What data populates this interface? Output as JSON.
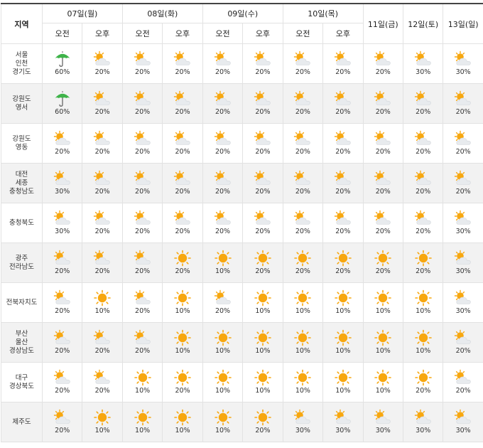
{
  "header": {
    "region_label": "지역",
    "days_split": [
      {
        "label": "07일(월)"
      },
      {
        "label": "08일(화)"
      },
      {
        "label": "09일(수)"
      },
      {
        "label": "10일(목)"
      }
    ],
    "days_single": [
      {
        "label": "11일(금)"
      },
      {
        "label": "12일(토)"
      },
      {
        "label": "13일(일)"
      }
    ],
    "am_label": "오전",
    "pm_label": "오후"
  },
  "rows": [
    {
      "region": "서울\n인천\n경기도",
      "cells": [
        {
          "icon": "umbrella-icon",
          "pct": "60%"
        },
        {
          "icon": "partly-cloudy-icon",
          "pct": "20%"
        },
        {
          "icon": "partly-cloudy-icon",
          "pct": "20%"
        },
        {
          "icon": "partly-cloudy-icon",
          "pct": "20%"
        },
        {
          "icon": "partly-cloudy-icon",
          "pct": "20%"
        },
        {
          "icon": "partly-cloudy-icon",
          "pct": "20%"
        },
        {
          "icon": "partly-cloudy-icon",
          "pct": "20%"
        },
        {
          "icon": "partly-cloudy-icon",
          "pct": "20%"
        },
        {
          "icon": "partly-cloudy-icon",
          "pct": "20%"
        },
        {
          "icon": "partly-cloudy-icon",
          "pct": "30%"
        },
        {
          "icon": "partly-cloudy-icon",
          "pct": "30%"
        }
      ]
    },
    {
      "region": "강원도\n영서",
      "cells": [
        {
          "icon": "umbrella-icon",
          "pct": "60%"
        },
        {
          "icon": "partly-cloudy-icon",
          "pct": "20%"
        },
        {
          "icon": "partly-cloudy-icon",
          "pct": "20%"
        },
        {
          "icon": "partly-cloudy-icon",
          "pct": "20%"
        },
        {
          "icon": "partly-cloudy-icon",
          "pct": "20%"
        },
        {
          "icon": "partly-cloudy-icon",
          "pct": "20%"
        },
        {
          "icon": "partly-cloudy-icon",
          "pct": "20%"
        },
        {
          "icon": "partly-cloudy-icon",
          "pct": "20%"
        },
        {
          "icon": "partly-cloudy-icon",
          "pct": "20%"
        },
        {
          "icon": "partly-cloudy-icon",
          "pct": "20%"
        },
        {
          "icon": "partly-cloudy-icon",
          "pct": "20%"
        }
      ]
    },
    {
      "region": "강원도\n영동",
      "cells": [
        {
          "icon": "partly-cloudy-icon",
          "pct": "20%"
        },
        {
          "icon": "partly-cloudy-icon",
          "pct": "20%"
        },
        {
          "icon": "partly-cloudy-icon",
          "pct": "20%"
        },
        {
          "icon": "partly-cloudy-icon",
          "pct": "20%"
        },
        {
          "icon": "partly-cloudy-icon",
          "pct": "20%"
        },
        {
          "icon": "partly-cloudy-icon",
          "pct": "20%"
        },
        {
          "icon": "partly-cloudy-icon",
          "pct": "20%"
        },
        {
          "icon": "partly-cloudy-icon",
          "pct": "20%"
        },
        {
          "icon": "partly-cloudy-icon",
          "pct": "20%"
        },
        {
          "icon": "partly-cloudy-icon",
          "pct": "20%"
        },
        {
          "icon": "partly-cloudy-icon",
          "pct": "20%"
        }
      ]
    },
    {
      "region": "대전\n세종\n충청남도",
      "cells": [
        {
          "icon": "partly-cloudy-icon",
          "pct": "30%"
        },
        {
          "icon": "partly-cloudy-icon",
          "pct": "20%"
        },
        {
          "icon": "partly-cloudy-icon",
          "pct": "20%"
        },
        {
          "icon": "partly-cloudy-icon",
          "pct": "20%"
        },
        {
          "icon": "partly-cloudy-icon",
          "pct": "20%"
        },
        {
          "icon": "partly-cloudy-icon",
          "pct": "20%"
        },
        {
          "icon": "partly-cloudy-icon",
          "pct": "20%"
        },
        {
          "icon": "partly-cloudy-icon",
          "pct": "20%"
        },
        {
          "icon": "partly-cloudy-icon",
          "pct": "20%"
        },
        {
          "icon": "partly-cloudy-icon",
          "pct": "20%"
        },
        {
          "icon": "partly-cloudy-icon",
          "pct": "20%"
        }
      ]
    },
    {
      "region": "충청북도",
      "cells": [
        {
          "icon": "partly-cloudy-icon",
          "pct": "30%"
        },
        {
          "icon": "partly-cloudy-icon",
          "pct": "20%"
        },
        {
          "icon": "partly-cloudy-icon",
          "pct": "20%"
        },
        {
          "icon": "partly-cloudy-icon",
          "pct": "20%"
        },
        {
          "icon": "partly-cloudy-icon",
          "pct": "20%"
        },
        {
          "icon": "partly-cloudy-icon",
          "pct": "20%"
        },
        {
          "icon": "partly-cloudy-icon",
          "pct": "20%"
        },
        {
          "icon": "partly-cloudy-icon",
          "pct": "20%"
        },
        {
          "icon": "partly-cloudy-icon",
          "pct": "20%"
        },
        {
          "icon": "partly-cloudy-icon",
          "pct": "20%"
        },
        {
          "icon": "partly-cloudy-icon",
          "pct": "30%"
        }
      ]
    },
    {
      "region": "광주\n전라남도",
      "cells": [
        {
          "icon": "partly-cloudy-icon",
          "pct": "20%"
        },
        {
          "icon": "partly-cloudy-icon",
          "pct": "20%"
        },
        {
          "icon": "partly-cloudy-icon",
          "pct": "20%"
        },
        {
          "icon": "sun-icon",
          "pct": "20%"
        },
        {
          "icon": "sun-icon",
          "pct": "10%"
        },
        {
          "icon": "sun-icon",
          "pct": "20%"
        },
        {
          "icon": "sun-icon",
          "pct": "20%"
        },
        {
          "icon": "sun-icon",
          "pct": "20%"
        },
        {
          "icon": "sun-icon",
          "pct": "20%"
        },
        {
          "icon": "sun-icon",
          "pct": "20%"
        },
        {
          "icon": "partly-cloudy-icon",
          "pct": "30%"
        }
      ]
    },
    {
      "region": "전북자치도",
      "cells": [
        {
          "icon": "partly-cloudy-icon",
          "pct": "20%"
        },
        {
          "icon": "sun-icon",
          "pct": "10%"
        },
        {
          "icon": "partly-cloudy-icon",
          "pct": "20%"
        },
        {
          "icon": "sun-icon",
          "pct": "10%"
        },
        {
          "icon": "partly-cloudy-icon",
          "pct": "20%"
        },
        {
          "icon": "sun-icon",
          "pct": "10%"
        },
        {
          "icon": "sun-icon",
          "pct": "10%"
        },
        {
          "icon": "sun-icon",
          "pct": "10%"
        },
        {
          "icon": "sun-icon",
          "pct": "10%"
        },
        {
          "icon": "sun-icon",
          "pct": "10%"
        },
        {
          "icon": "partly-cloudy-icon",
          "pct": "30%"
        }
      ]
    },
    {
      "region": "부산\n울산\n경상남도",
      "cells": [
        {
          "icon": "partly-cloudy-icon",
          "pct": "20%"
        },
        {
          "icon": "partly-cloudy-icon",
          "pct": "20%"
        },
        {
          "icon": "partly-cloudy-icon",
          "pct": "20%"
        },
        {
          "icon": "sun-icon",
          "pct": "10%"
        },
        {
          "icon": "sun-icon",
          "pct": "10%"
        },
        {
          "icon": "sun-icon",
          "pct": "10%"
        },
        {
          "icon": "sun-icon",
          "pct": "10%"
        },
        {
          "icon": "sun-icon",
          "pct": "10%"
        },
        {
          "icon": "sun-icon",
          "pct": "10%"
        },
        {
          "icon": "sun-icon",
          "pct": "10%"
        },
        {
          "icon": "partly-cloudy-icon",
          "pct": "20%"
        }
      ]
    },
    {
      "region": "대구\n경상북도",
      "cells": [
        {
          "icon": "partly-cloudy-icon",
          "pct": "20%"
        },
        {
          "icon": "partly-cloudy-icon",
          "pct": "20%"
        },
        {
          "icon": "sun-icon",
          "pct": "10%"
        },
        {
          "icon": "sun-icon",
          "pct": "20%"
        },
        {
          "icon": "sun-icon",
          "pct": "10%"
        },
        {
          "icon": "sun-icon",
          "pct": "10%"
        },
        {
          "icon": "sun-icon",
          "pct": "10%"
        },
        {
          "icon": "sun-icon",
          "pct": "10%"
        },
        {
          "icon": "sun-icon",
          "pct": "10%"
        },
        {
          "icon": "sun-icon",
          "pct": "20%"
        },
        {
          "icon": "partly-cloudy-icon",
          "pct": "20%"
        }
      ]
    },
    {
      "region": "제주도",
      "cells": [
        {
          "icon": "partly-cloudy-icon",
          "pct": "20%"
        },
        {
          "icon": "sun-icon",
          "pct": "10%"
        },
        {
          "icon": "sun-icon",
          "pct": "10%"
        },
        {
          "icon": "sun-icon",
          "pct": "10%"
        },
        {
          "icon": "sun-icon",
          "pct": "10%"
        },
        {
          "icon": "sun-icon",
          "pct": "20%"
        },
        {
          "icon": "partly-cloudy-icon",
          "pct": "30%"
        },
        {
          "icon": "partly-cloudy-icon",
          "pct": "30%"
        },
        {
          "icon": "partly-cloudy-icon",
          "pct": "30%"
        },
        {
          "icon": "partly-cloudy-icon",
          "pct": "30%"
        },
        {
          "icon": "partly-cloudy-icon",
          "pct": "30%"
        }
      ]
    }
  ],
  "colors": {
    "sun": "#f7a70f",
    "cloud": "#e8ebee",
    "umbrella": "#3fb34a",
    "shade": "#f2f2f2"
  }
}
